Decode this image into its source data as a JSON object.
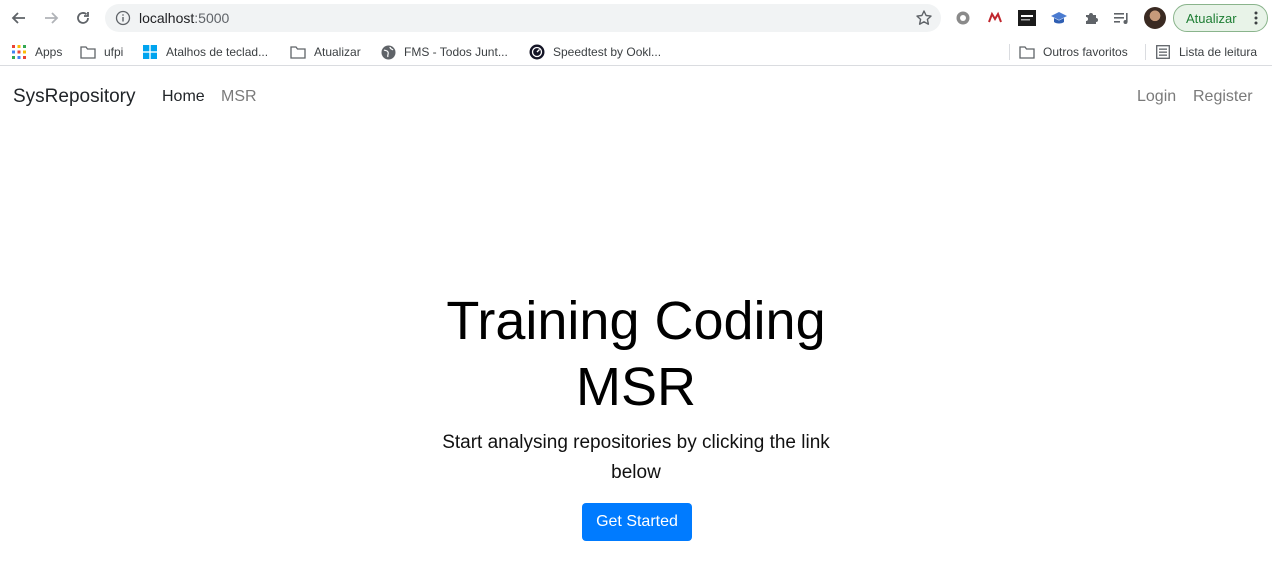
{
  "browser": {
    "url_host": "localhost",
    "url_port": ":5000",
    "update_label": "Atualizar",
    "bookmarks": {
      "apps": "Apps",
      "ufpi": "ufpi",
      "atalhos": "Atalhos de teclad...",
      "atualizar": "Atualizar",
      "fms": "FMS - Todos Junt...",
      "speedtest": "Speedtest by Ookl...",
      "outros": "Outros favoritos",
      "lista": "Lista de leitura"
    }
  },
  "navbar": {
    "brand": "SysRepository",
    "home": "Home",
    "msr": "MSR",
    "login": "Login",
    "register": "Register"
  },
  "hero": {
    "title": "Training Coding MSR",
    "subtitle": "Start analysing repositories by clicking the link below",
    "cta": "Get Started"
  },
  "colors": {
    "primary": "#007bff",
    "update_green": "#1e7e34"
  }
}
